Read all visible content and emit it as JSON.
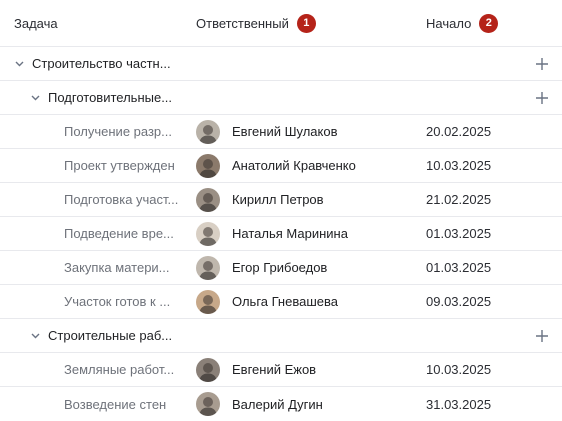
{
  "columns": {
    "task": "Задача",
    "owner": "Ответственный",
    "owner_badge": "1",
    "start": "Начало",
    "start_badge": "2"
  },
  "groups": [
    {
      "label": "Строительство частн..."
    },
    {
      "label": "Подготовительные..."
    },
    {
      "label": "Строительные раб..."
    }
  ],
  "tasks": [
    {
      "label": "Получение разр...",
      "owner": "Евгений Шулаков",
      "start": "20.02.2025",
      "avatar_bg": "#b9b2a8"
    },
    {
      "label": "Проект утвержден",
      "owner": "Анатолий Кравченко",
      "start": "10.03.2025",
      "avatar_bg": "#8b7a6b"
    },
    {
      "label": "Подготовка участ...",
      "owner": "Кирилл Петров",
      "start": "21.02.2025",
      "avatar_bg": "#9a8f84"
    },
    {
      "label": "Подведение вре...",
      "owner": "Наталья Маринина",
      "start": "01.03.2025",
      "avatar_bg": "#d8cfc4"
    },
    {
      "label": "Закупка матери...",
      "owner": "Егор Грибоедов",
      "start": "01.03.2025",
      "avatar_bg": "#bfb7ad"
    },
    {
      "label": "Участок готов к ...",
      "owner": "Ольга Гневашева",
      "start": "09.03.2025",
      "avatar_bg": "#c7a889"
    },
    {
      "label": "Земляные работ...",
      "owner": "Евгений Ежов",
      "start": "10.03.2025",
      "avatar_bg": "#8a8078"
    },
    {
      "label": "Возведение стен",
      "owner": "Валерий Дугин",
      "start": "31.03.2025",
      "avatar_bg": "#a89c90"
    }
  ],
  "colors": {
    "badge": "#b52319",
    "chevron": "#6a7383",
    "divider": "#e8e9ed"
  },
  "icons": {
    "expand": "chevron-down-icon",
    "add": "plus-icon"
  }
}
